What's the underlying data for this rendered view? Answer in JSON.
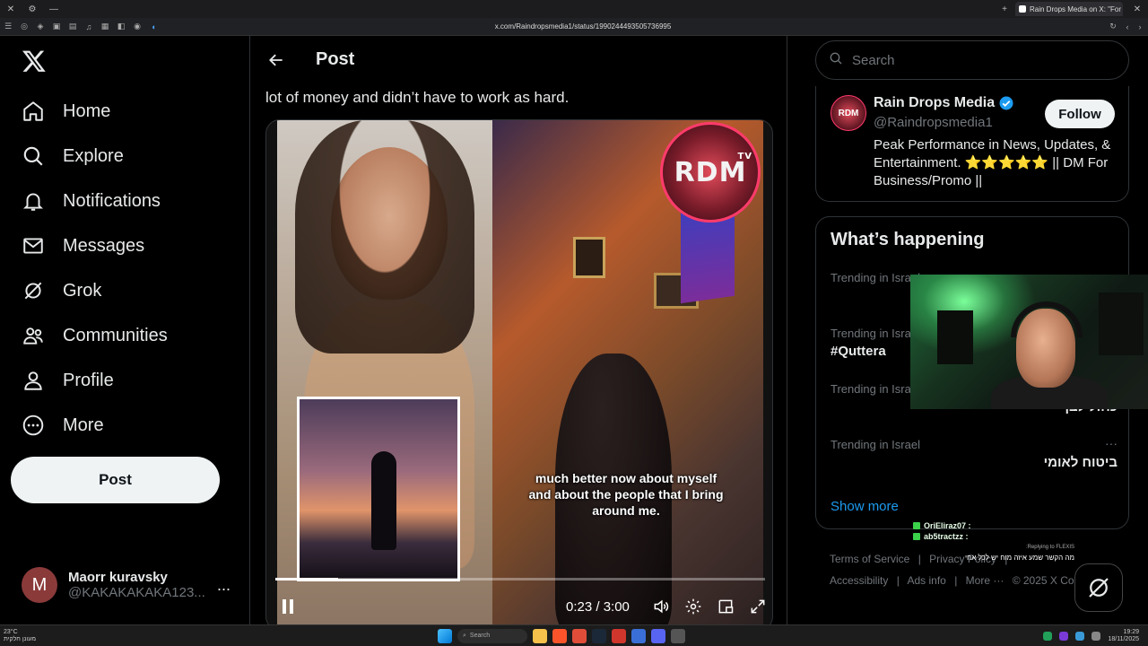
{
  "browser": {
    "tab_title": "Rain Drops Media on X: \"For",
    "url": "x.com/Raindropsmedia1/status/1990244493505736995"
  },
  "nav": {
    "items": [
      {
        "label": "Home",
        "icon": "home-icon"
      },
      {
        "label": "Explore",
        "icon": "search-icon"
      },
      {
        "label": "Notifications",
        "icon": "bell-icon"
      },
      {
        "label": "Messages",
        "icon": "envelope-icon"
      },
      {
        "label": "Grok",
        "icon": "grok-icon"
      },
      {
        "label": "Communities",
        "icon": "people-icon"
      },
      {
        "label": "Profile",
        "icon": "person-icon"
      },
      {
        "label": "More",
        "icon": "more-circle-icon"
      }
    ],
    "post_button": "Post",
    "account": {
      "avatar_letter": "M",
      "name": "Maorr kuravsky",
      "handle": "@KAKAKAKAKA123...",
      "more": "..."
    }
  },
  "main": {
    "header_title": "Post",
    "post_text": "lot of money and didn’t have to work as hard.",
    "video": {
      "caption": "much better now about myself and about the people that I bring around me.",
      "logo_text": "RDM",
      "logo_sub": "TV",
      "timecode": "0:23 / 3:00",
      "progress_fraction": 0.128
    }
  },
  "right": {
    "search_placeholder": "Search",
    "profile": {
      "name": "Rain Drops Media",
      "handle": "@Raindropsmedia1",
      "bio": "Peak Performance in News, Updates, & Entertainment. ⭐⭐⭐⭐⭐ || DM For Business/Promo ||",
      "follow_label": "Follow",
      "avatar_text": "RDM"
    },
    "trending": {
      "title": "What’s happening",
      "items": [
        {
          "context": "Trending in Israel",
          "topic": ""
        },
        {
          "context": "Trending in Israel",
          "topic": "#Quttera"
        },
        {
          "context": "Trending in Israel",
          "topic": "כחול לבן"
        },
        {
          "context": "Trending in Israel",
          "topic": "ביטוח לאומי"
        }
      ],
      "more_dots": "···",
      "show_more": "Show more"
    },
    "footer": {
      "line1": [
        "Terms of Service",
        "|",
        "Privacy Policy",
        "|"
      ],
      "line2": [
        "Accessibility",
        "|",
        "Ads info",
        "|",
        "More ···",
        "© 2025 X Corp."
      ]
    }
  },
  "chat": {
    "rows": [
      {
        "user": "OriEliraz07 :",
        "msg": ""
      },
      {
        "user": "ab5tractzz :",
        "msg": "מה הקשר שמע איזה מוח יש לכל אחי"
      }
    ],
    "reply_note": "Replying to FLEXIS:"
  },
  "taskbar": {
    "weather_temp": "23°C",
    "weather_desc": "מעונן חלקית",
    "search_label": "Search",
    "time": "19:29",
    "date": "18/11/2025"
  },
  "colors": {
    "accent_blue": "#1d9bf0",
    "verified_blue": "#1d9bf0",
    "text_primary": "#e7e9ea",
    "text_secondary": "#71767b"
  }
}
